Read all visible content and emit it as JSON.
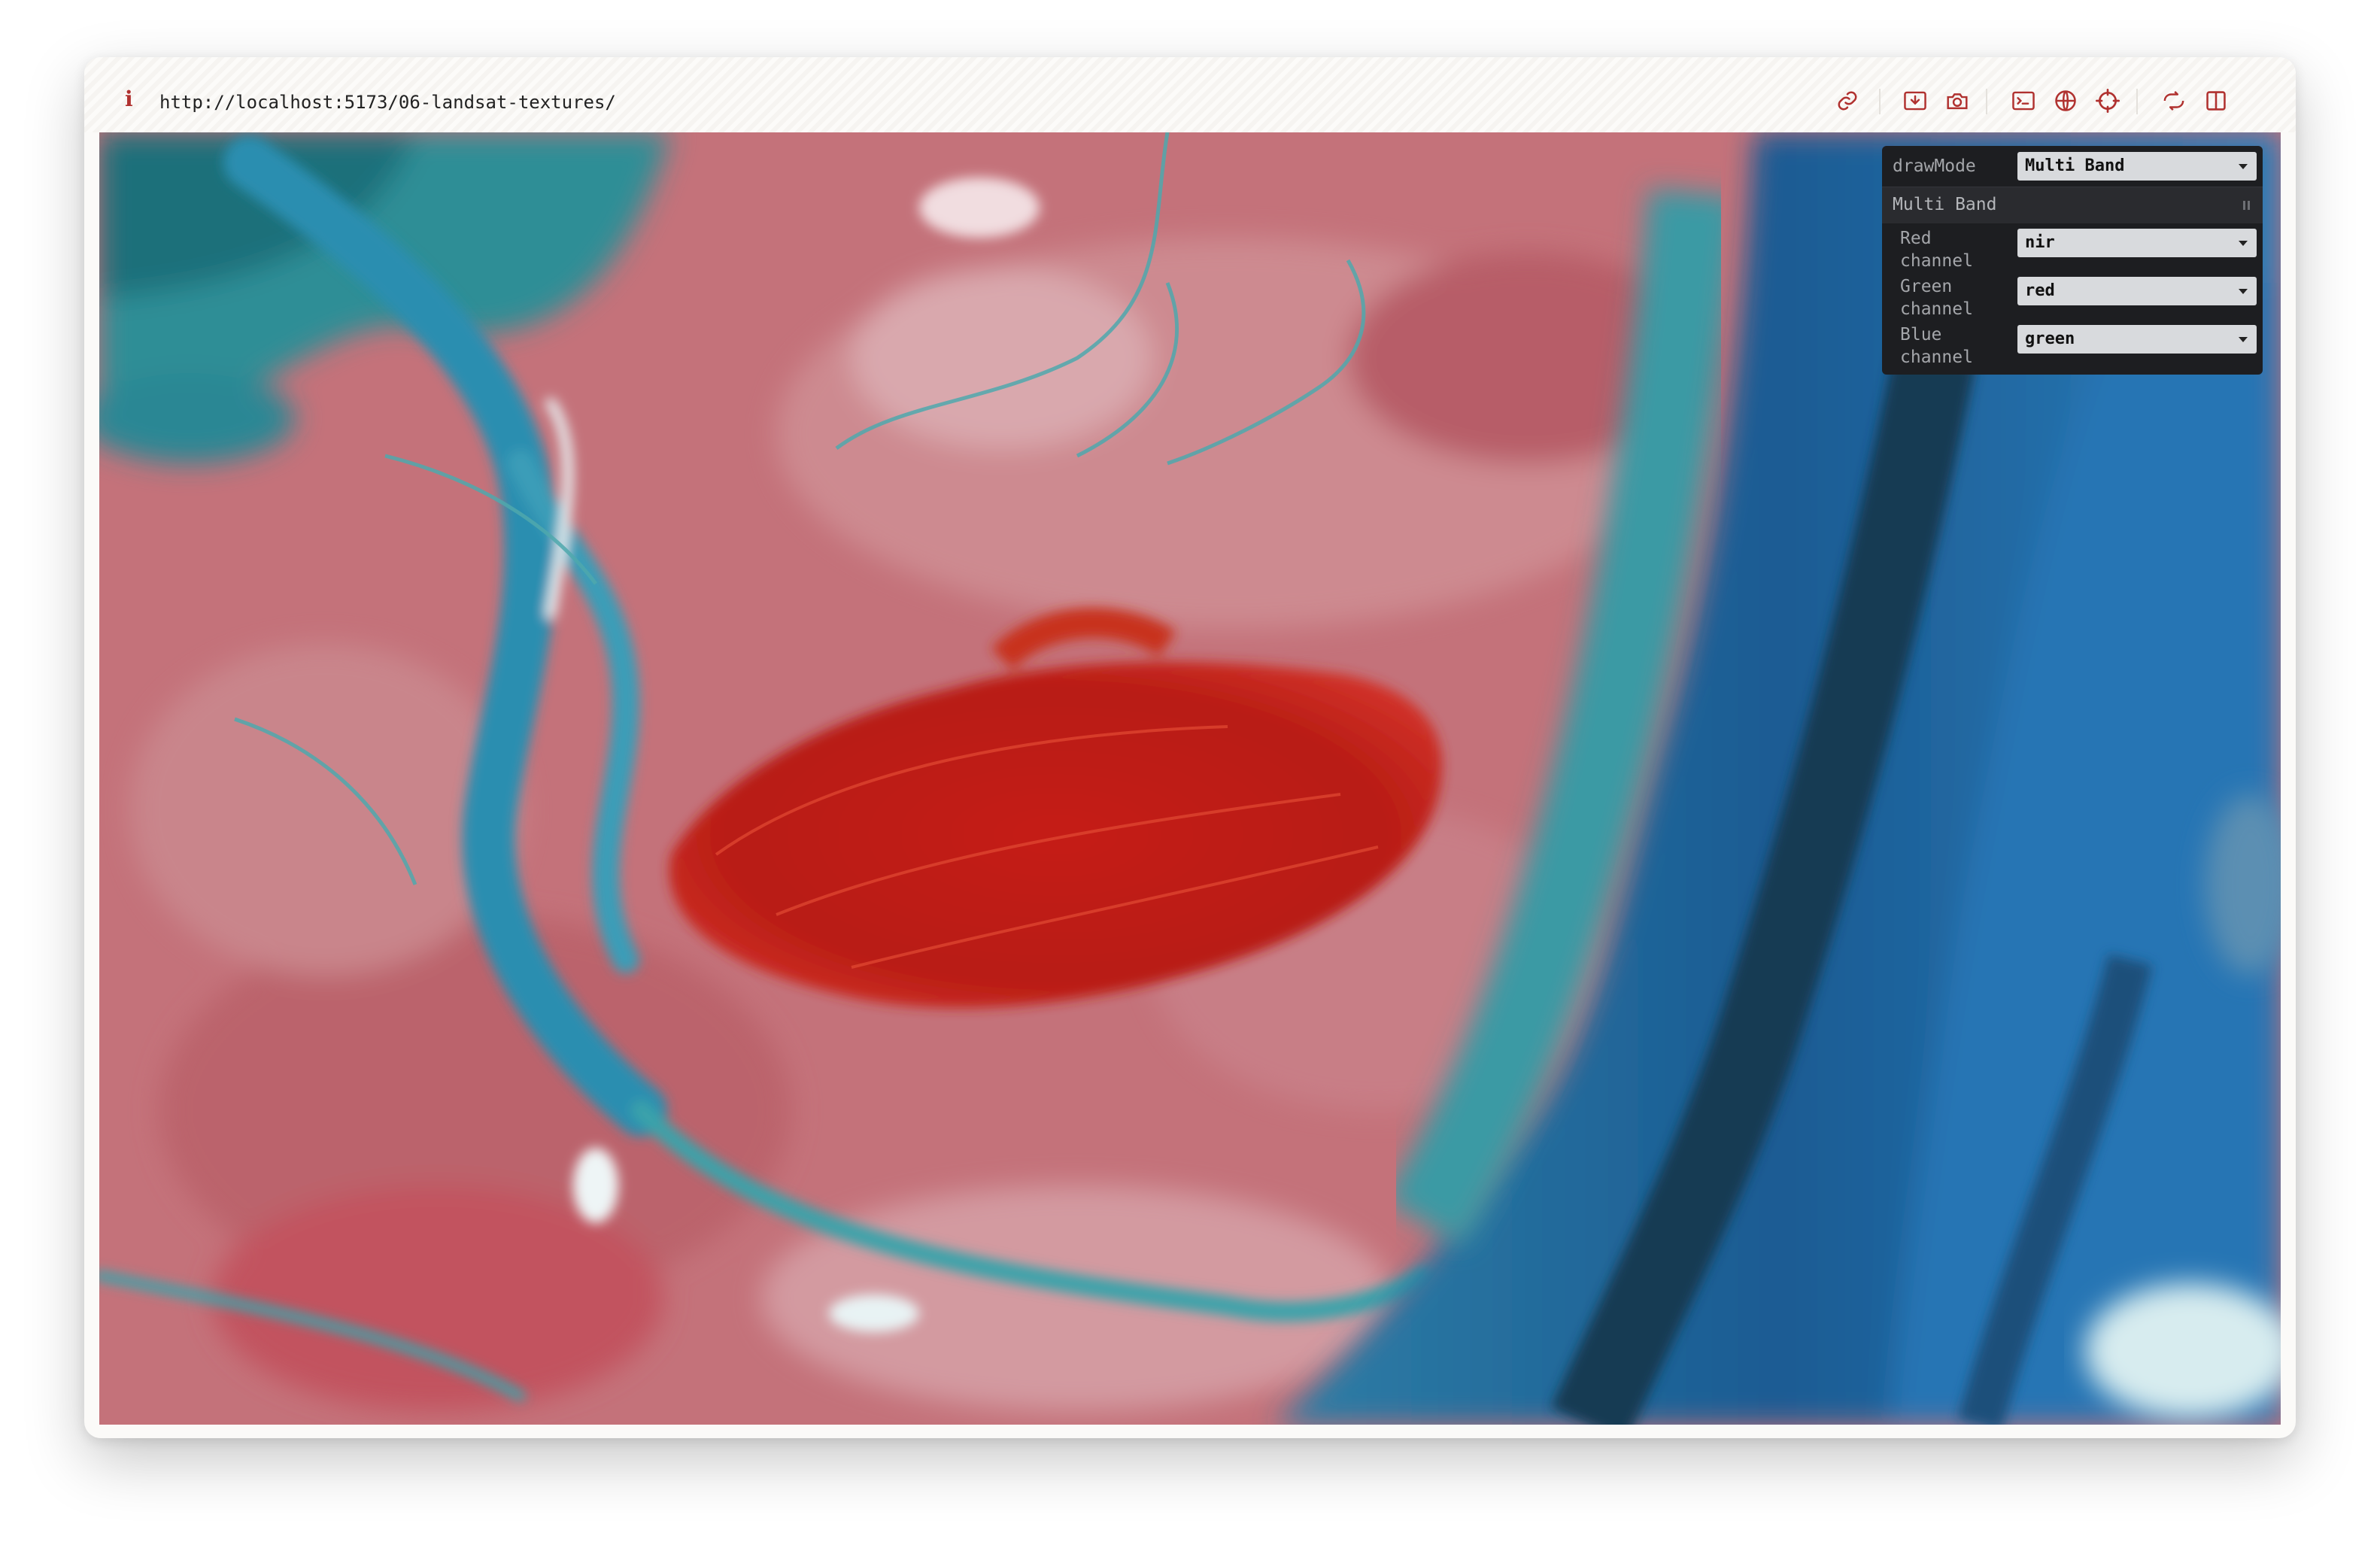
{
  "browser": {
    "url": "http://localhost:5173/06-landsat-textures/",
    "info_icon": "i",
    "toolbar_icons": [
      "link-icon",
      "download-icon",
      "camera-icon",
      "terminal-icon",
      "globe-icon",
      "crosshair-icon",
      "sync-icon",
      "sidebar-icon"
    ]
  },
  "gui": {
    "draw_mode": {
      "label": "drawMode",
      "value": "Multi Band"
    },
    "folder": {
      "title": "Multi Band",
      "controls": [
        {
          "label_line1": "Red",
          "label_line2": "channel",
          "value": "nir"
        },
        {
          "label_line1": "Green",
          "label_line2": "channel",
          "value": "red"
        },
        {
          "label_line1": "Blue",
          "label_line2": "channel",
          "value": "green"
        }
      ]
    }
  },
  "colors": {
    "accent": "#b0312f",
    "panel_bg": "#1d1e21",
    "select_bg": "#d8dadd"
  }
}
